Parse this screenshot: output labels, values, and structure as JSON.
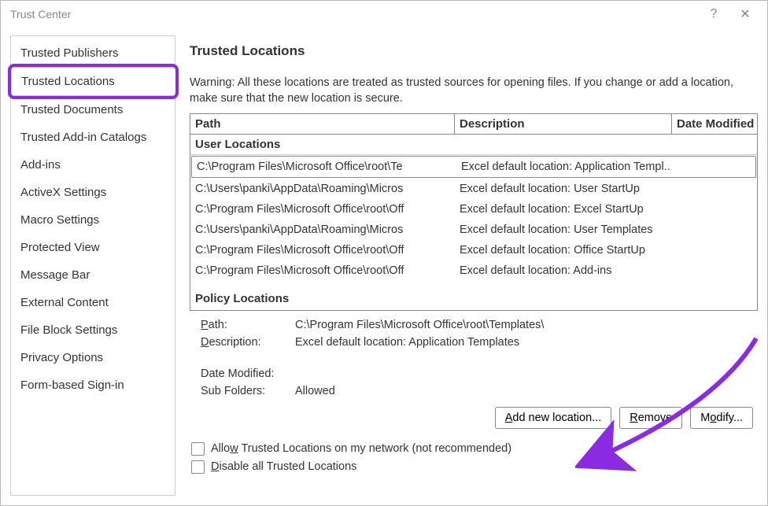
{
  "window": {
    "title": "Trust Center",
    "help_icon": "?",
    "close_icon": "✕"
  },
  "sidebar": {
    "items": [
      {
        "label": "Trusted Publishers"
      },
      {
        "label": "Trusted Locations",
        "selected": true
      },
      {
        "label": "Trusted Documents"
      },
      {
        "label": "Trusted Add-in Catalogs"
      },
      {
        "label": "Add-ins"
      },
      {
        "label": "ActiveX Settings"
      },
      {
        "label": "Macro Settings"
      },
      {
        "label": "Protected View"
      },
      {
        "label": "Message Bar"
      },
      {
        "label": "External Content"
      },
      {
        "label": "File Block Settings"
      },
      {
        "label": "Privacy Options"
      },
      {
        "label": "Form-based Sign-in"
      }
    ]
  },
  "main": {
    "heading": "Trusted Locations",
    "warning": "Warning: All these locations are treated as trusted sources for opening files.  If you change or add a location, make sure that the new location is secure.",
    "columns": {
      "path": "Path",
      "desc": "Description",
      "date": "Date Modified"
    },
    "section_user": "User Locations",
    "rows": [
      {
        "path": "C:\\Program Files\\Microsoft Office\\root\\Te",
        "desc": "Excel default location: Application Templ...",
        "selected": true
      },
      {
        "path": "C:\\Users\\panki\\AppData\\Roaming\\Micros",
        "desc": "Excel default location: User StartUp"
      },
      {
        "path": "C:\\Program Files\\Microsoft Office\\root\\Off",
        "desc": "Excel default location: Excel StartUp"
      },
      {
        "path": "C:\\Users\\panki\\AppData\\Roaming\\Micros",
        "desc": "Excel default location: User Templates"
      },
      {
        "path": "C:\\Program Files\\Microsoft Office\\root\\Off",
        "desc": "Excel default location: Office StartUp"
      },
      {
        "path": "C:\\Program Files\\Microsoft Office\\root\\Off",
        "desc": "Excel default location: Add-ins"
      }
    ],
    "section_policy": "Policy Locations",
    "details": {
      "path_label": "Path:",
      "path_value": "C:\\Program Files\\Microsoft Office\\root\\Templates\\",
      "desc_label": "Description:",
      "desc_value": "Excel default location: Application Templates",
      "date_label": "Date Modified:",
      "date_value": "",
      "sub_label": "Sub Folders:",
      "sub_value": "Allowed"
    },
    "buttons": {
      "add": "Add new location...",
      "remove": "Remove",
      "modify": "Modify..."
    },
    "checks": {
      "allow_net": "Allow Trusted Locations on my network (not recommended)",
      "disable_all": "Disable all Trusted Locations"
    }
  }
}
